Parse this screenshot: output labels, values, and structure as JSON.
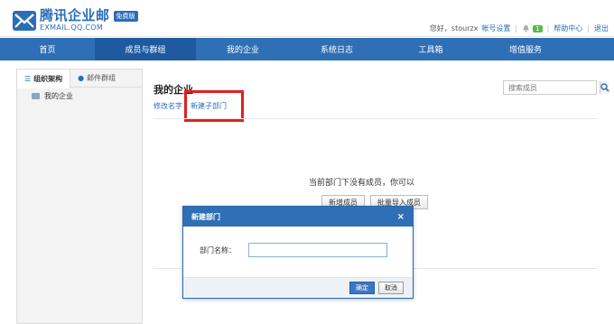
{
  "brand": {
    "title": "腾讯企业邮",
    "subtitle": "EXMAIL.QQ.COM",
    "badge": "免费版",
    "accent_color": "#2f6fb6"
  },
  "userbar": {
    "greeting": "您好，stourzx",
    "account_settings": "帐号设置",
    "notification_count": "1",
    "help": "帮助中心",
    "logout": "退出"
  },
  "nav": {
    "items": [
      {
        "label": "首页"
      },
      {
        "label": "成员与群组"
      },
      {
        "label": "我的企业"
      },
      {
        "label": "系统日志"
      },
      {
        "label": "工具箱"
      },
      {
        "label": "增值服务"
      }
    ],
    "active": "成员与群组"
  },
  "sidebar": {
    "tabs": [
      {
        "label": "组织架构"
      },
      {
        "label": "邮件群组"
      }
    ],
    "tree": [
      {
        "label": "我的企业"
      }
    ]
  },
  "main": {
    "title": "我的企业",
    "rename_link": "修改名字",
    "new_subdept_link": "新建子部门",
    "search_placeholder": "搜索成员",
    "empty_message": "当前部门下没有成员，你可以",
    "add_member_button": "新增成员",
    "bulk_import_button": "批量导入成员"
  },
  "dialog": {
    "title": "新建部门",
    "close": "×",
    "field_label": "部门名称：",
    "field_value": "",
    "confirm": "确定",
    "cancel": "取消"
  }
}
